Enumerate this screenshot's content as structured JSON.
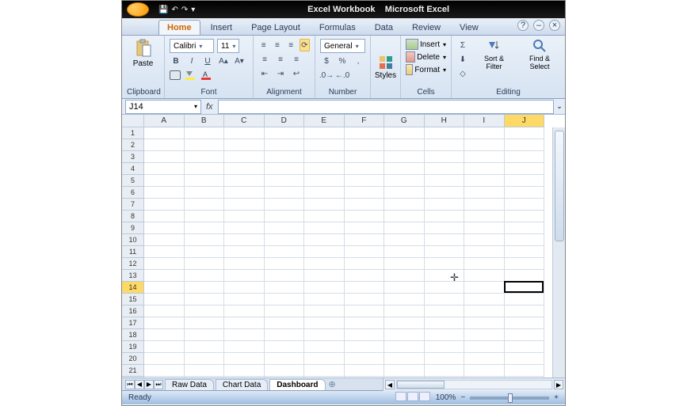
{
  "title_bar": {
    "doc_name": "Excel Workbook",
    "app_name": "Microsoft Excel"
  },
  "qat": {
    "save": "💾",
    "undo": "↶",
    "redo": "↷",
    "more": "▾"
  },
  "tabs": {
    "home": "Home",
    "insert": "Insert",
    "page_layout": "Page Layout",
    "formulas": "Formulas",
    "data": "Data",
    "review": "Review",
    "view": "View"
  },
  "ribbon": {
    "clipboard": {
      "title": "Clipboard",
      "paste": "Paste"
    },
    "font": {
      "title": "Font",
      "font_name": "Calibri",
      "font_size": "11",
      "bold": "B",
      "italic": "I",
      "underline": "U"
    },
    "alignment": {
      "title": "Alignment"
    },
    "number": {
      "title": "Number",
      "format": "General",
      "currency": "$",
      "percent": "%",
      "comma": ","
    },
    "styles": {
      "title": "Styles"
    },
    "cells": {
      "title": "Cells",
      "insert": "Insert",
      "delete": "Delete",
      "format": "Format"
    },
    "editing": {
      "title": "Editing",
      "sort": "Sort & Filter",
      "find": "Find & Select",
      "sigma": "Σ",
      "fill": "⬇",
      "clear": "◇"
    }
  },
  "namebox": {
    "cell_ref": "J14"
  },
  "formula_bar": {
    "fx": "fx"
  },
  "columns": [
    "A",
    "B",
    "C",
    "D",
    "E",
    "F",
    "G",
    "H",
    "I",
    "J"
  ],
  "active_col_index": 9,
  "rows_count": 22,
  "active_row": 14,
  "sheet_tabs": {
    "raw": "Raw Data",
    "chart": "Chart Data",
    "dash": "Dashboard"
  },
  "status": {
    "ready": "Ready",
    "zoom": "100%"
  }
}
